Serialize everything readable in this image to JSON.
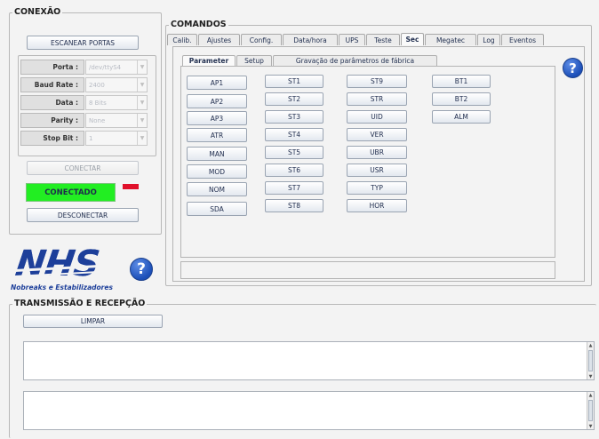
{
  "conexao": {
    "title": "CONEXÃO",
    "scan_button": "ESCANEAR PORTAS",
    "fields": [
      {
        "label": "Porta :",
        "value": "/dev/ttyS4"
      },
      {
        "label": "Baud Rate :",
        "value": "2400"
      },
      {
        "label": "Data :",
        "value": "8 Bits"
      },
      {
        "label": "Parity :",
        "value": "None"
      },
      {
        "label": "Stop Bit :",
        "value": "1"
      }
    ],
    "connect_button": "CONECTAR",
    "status_text": "CONECTADO",
    "status_color": "#22ee22",
    "indicator_color": "#e0102a",
    "disconnect_button": "DESCONECTAR"
  },
  "logo": {
    "brand": "NHS",
    "tagline": "Nobreaks e Estabilizadores",
    "brand_color": "#1d3f9a"
  },
  "comandos": {
    "title": "COMANDOS",
    "tabs": [
      "Calib.",
      "Ajustes",
      "Config.",
      "Data/hora",
      "UPS",
      "Teste",
      "Sec",
      "Megatec",
      "Log",
      "Eventos"
    ],
    "active_tab": "Sec",
    "subtabs": [
      "Parameter",
      "Setup",
      "Gravação de parâmetros de fábrica"
    ],
    "active_subtab": "Parameter",
    "columns": [
      [
        "AP1",
        "AP2",
        "AP3",
        "ATR",
        "MAN",
        "MOD",
        "NOM",
        "SDA"
      ],
      [
        "ST1",
        "ST2",
        "ST3",
        "ST4",
        "ST5",
        "ST6",
        "ST7",
        "ST8"
      ],
      [
        "ST9",
        "STR",
        "UID",
        "VER",
        "UBR",
        "USR",
        "TYP",
        "HOR"
      ],
      [
        "BT1",
        "BT2",
        "ALM"
      ]
    ],
    "status_field": ""
  },
  "transmissao": {
    "title": "TRANSMISSÃO E RECEPÇÃO",
    "clear_button": "LIMPAR",
    "tx_text": "",
    "rx_text": ""
  },
  "colors": {
    "help_icon": "#1c4fb8",
    "background": "#f3f3f3"
  }
}
